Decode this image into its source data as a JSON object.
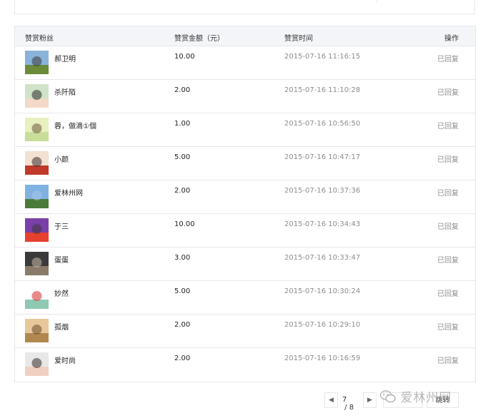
{
  "table": {
    "headers": {
      "user": "赞赏粉丝",
      "amount": "赞赏金额（元）",
      "time": "赞赏时间",
      "action": "操作"
    },
    "rows": [
      {
        "nickname": "郝卫明",
        "amount": "10.00",
        "time": "2015-07-16 11:16:15",
        "action": "已回复",
        "avatar_colors": [
          "#8bb3d9",
          "#6b8a3a",
          "#3a3a3a"
        ]
      },
      {
        "nickname": "杀阡陌",
        "amount": "2.00",
        "time": "2015-07-16 11:10:28",
        "action": "已回复",
        "avatar_colors": [
          "#cfe3c8",
          "#f2d9c8",
          "#2c2a2a"
        ]
      },
      {
        "nickname": "蓉，做滴①個",
        "amount": "1.00",
        "time": "2015-07-16 10:56:50",
        "action": "已回复",
        "avatar_colors": [
          "#e8f0c0",
          "#c9dd9a",
          "#6b5a3a"
        ]
      },
      {
        "nickname": "小颜",
        "amount": "5.00",
        "time": "2015-07-16 10:47:17",
        "action": "已回复",
        "avatar_colors": [
          "#f3e1d2",
          "#c0392b",
          "#3b2a2a"
        ]
      },
      {
        "nickname": "爱林州网",
        "amount": "2.00",
        "time": "2015-07-16 10:37:36",
        "action": "已回复",
        "avatar_colors": [
          "#7fb2e0",
          "#4a7b3a",
          "#a8c8e8"
        ]
      },
      {
        "nickname": "于三",
        "amount": "10.00",
        "time": "2015-07-16 10:34:43",
        "action": "已回复",
        "avatar_colors": [
          "#7a3fa8",
          "#e6402e",
          "#3a3a3a"
        ]
      },
      {
        "nickname": "蛋蛋",
        "amount": "3.00",
        "time": "2015-07-16 10:33:47",
        "action": "已回复",
        "avatar_colors": [
          "#3a3a3a",
          "#8a7a6a",
          "#c8b8a8"
        ]
      },
      {
        "nickname": "妙然",
        "amount": "5.00",
        "time": "2015-07-16 10:30:24",
        "action": "已回复",
        "avatar_colors": [
          "#ffffff",
          "#8fc9b2",
          "#d92b2b"
        ]
      },
      {
        "nickname": "孤烟",
        "amount": "2.00",
        "time": "2015-07-16 10:29:10",
        "action": "已回复",
        "avatar_colors": [
          "#e8c89a",
          "#b08850",
          "#6a4a2a"
        ]
      },
      {
        "nickname": "爱时尚",
        "amount": "2.00",
        "time": "2015-07-16 10:16:59",
        "action": "已回复",
        "avatar_colors": [
          "#e8e8e8",
          "#f0d0c0",
          "#3a2a2a"
        ]
      }
    ]
  },
  "pagination": {
    "current_page": "7",
    "separator": " / ",
    "total_pages": "8",
    "prev_icon": "chevron-left-icon",
    "next_icon": "chevron-right-icon",
    "jump_label": "跳转"
  },
  "watermark": {
    "text": "爱林州网",
    "icon": "wechat-icon"
  }
}
